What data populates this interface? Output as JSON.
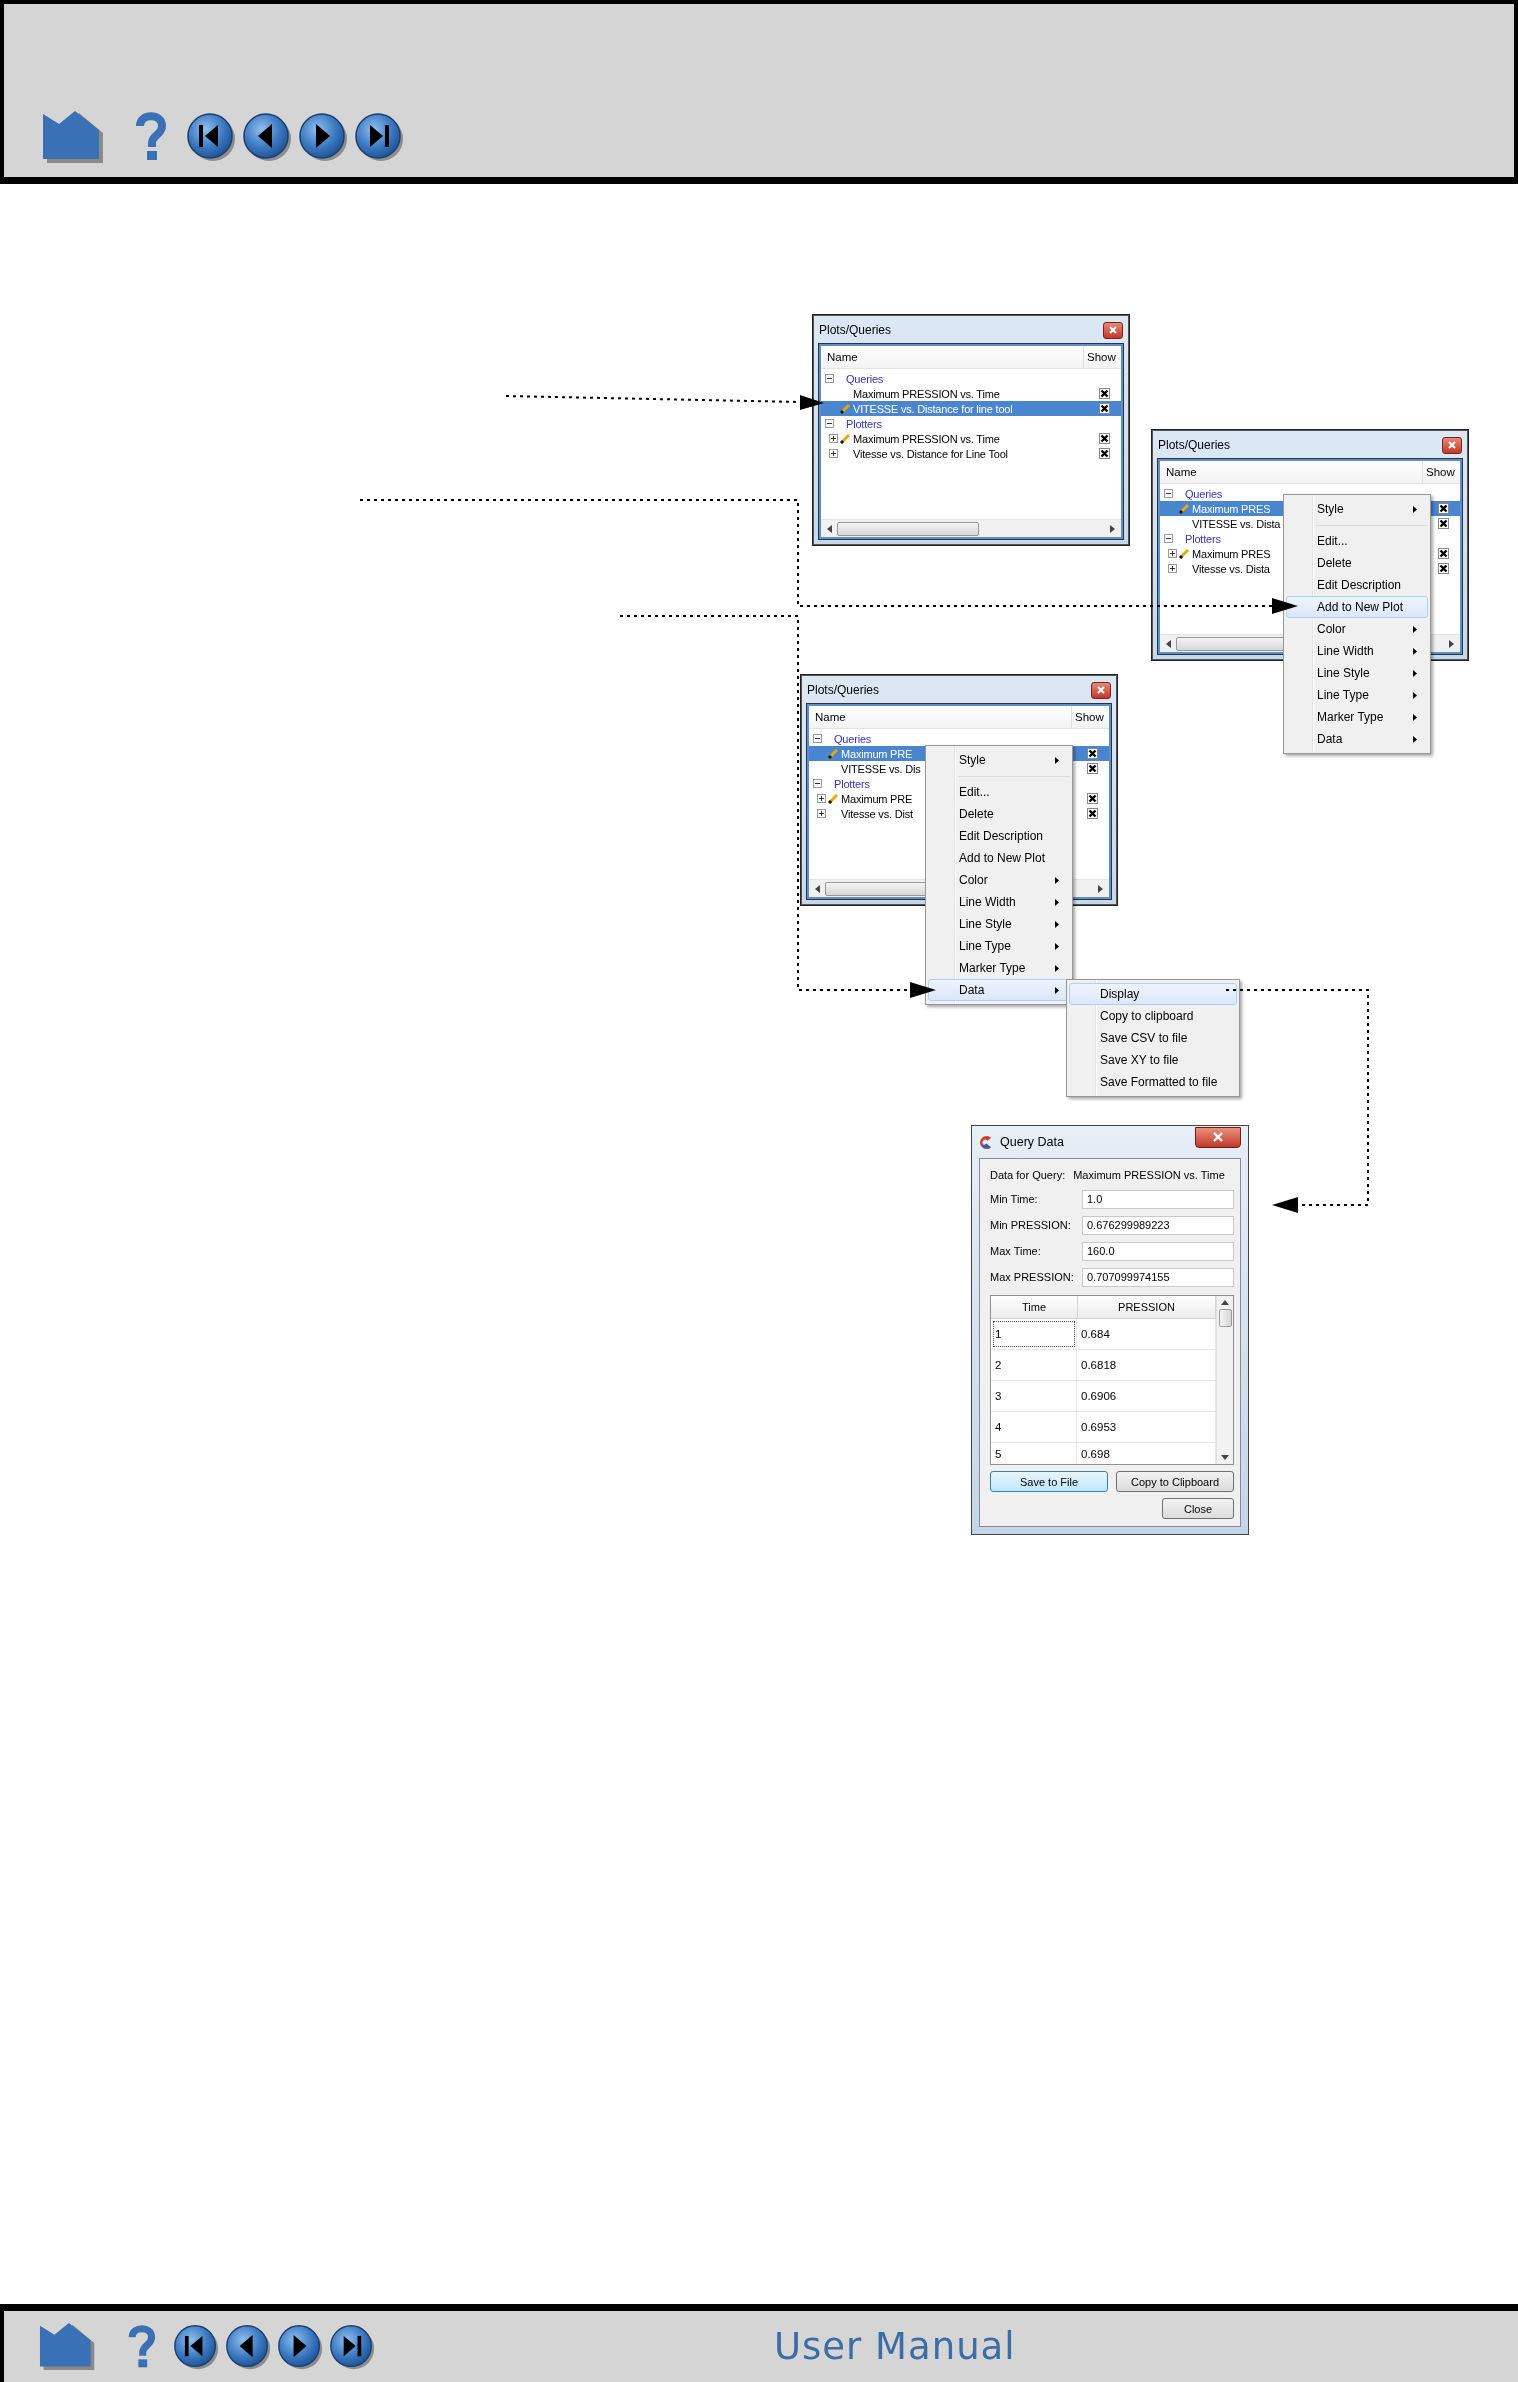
{
  "figures": [
    {
      "title": "Plots/Queries",
      "columns": [
        "Name",
        "Show"
      ],
      "tree": [
        {
          "label": "Queries",
          "expanded": true,
          "children": [
            {
              "label": "Maximum PRESSION vs. Time",
              "selected": false,
              "active": false,
              "has_children": false,
              "shown": true
            },
            {
              "label": "VITESSE vs. Distance for line tool",
              "selected": true,
              "active": true,
              "has_children": false,
              "shown": true
            }
          ]
        },
        {
          "label": "Plotters",
          "expanded": true,
          "children": [
            {
              "label": "Maximum PRESSION vs. Time",
              "selected": false,
              "active": true,
              "has_children": true,
              "shown": true
            },
            {
              "label": "Vitesse vs. Distance for Line Tool",
              "selected": false,
              "active": false,
              "has_children": true,
              "shown": true
            }
          ]
        }
      ]
    },
    {
      "title": "Plots/Queries",
      "columns": [
        "Name",
        "Show"
      ],
      "tree": [
        {
          "label": "Queries",
          "expanded": true,
          "children": [
            {
              "label": "Maximum PRES",
              "selected": true,
              "active": true,
              "has_children": false,
              "shown": true
            },
            {
              "label": "VITESSE vs. Dista",
              "selected": false,
              "active": false,
              "has_children": false,
              "shown": true
            }
          ]
        },
        {
          "label": "Plotters",
          "expanded": true,
          "children": [
            {
              "label": "Maximum PRES",
              "selected": false,
              "active": true,
              "has_children": true,
              "shown": true
            },
            {
              "label": "Vitesse vs. Dista",
              "selected": false,
              "active": false,
              "has_children": true,
              "shown": true
            }
          ]
        }
      ],
      "context_menu": {
        "items": [
          {
            "kind": "item",
            "label": "Style",
            "has_submenu": true,
            "selected": false
          },
          {
            "kind": "separator"
          },
          {
            "kind": "item",
            "label": "Edit...",
            "has_submenu": false,
            "selected": false
          },
          {
            "kind": "item",
            "label": "Delete",
            "has_submenu": false,
            "selected": false
          },
          {
            "kind": "item",
            "label": "Edit Description",
            "has_submenu": false,
            "selected": false
          },
          {
            "kind": "item",
            "label": "Add to New Plot",
            "has_submenu": false,
            "selected": true
          },
          {
            "kind": "item",
            "label": "Color",
            "has_submenu": true,
            "selected": false
          },
          {
            "kind": "item",
            "label": "Line Width",
            "has_submenu": true,
            "selected": false
          },
          {
            "kind": "item",
            "label": "Line Style",
            "has_submenu": true,
            "selected": false
          },
          {
            "kind": "item",
            "label": "Line Type",
            "has_submenu": true,
            "selected": false
          },
          {
            "kind": "item",
            "label": "Marker Type",
            "has_submenu": true,
            "selected": false
          },
          {
            "kind": "item",
            "label": "Data",
            "has_submenu": true,
            "selected": false
          }
        ]
      }
    },
    {
      "title": "Plots/Queries",
      "columns": [
        "Name",
        "Show"
      ],
      "tree": [
        {
          "label": "Queries",
          "expanded": true,
          "children": [
            {
              "label": "Maximum PRE",
              "selected": true,
              "active": true,
              "has_children": false,
              "shown": true
            },
            {
              "label": "VITESSE vs. Dis",
              "selected": false,
              "active": false,
              "has_children": false,
              "shown": true
            }
          ]
        },
        {
          "label": "Plotters",
          "expanded": true,
          "children": [
            {
              "label": "Maximum PRE",
              "selected": false,
              "active": true,
              "has_children": true,
              "shown": true
            },
            {
              "label": "Vitesse vs. Dist",
              "selected": false,
              "active": false,
              "has_children": true,
              "shown": true
            }
          ]
        }
      ],
      "context_menu": {
        "items": [
          {
            "kind": "item",
            "label": "Style",
            "has_submenu": true,
            "selected": false
          },
          {
            "kind": "separator"
          },
          {
            "kind": "item",
            "label": "Edit...",
            "has_submenu": false,
            "selected": false
          },
          {
            "kind": "item",
            "label": "Delete",
            "has_submenu": false,
            "selected": false
          },
          {
            "kind": "item",
            "label": "Edit Description",
            "has_submenu": false,
            "selected": false
          },
          {
            "kind": "item",
            "label": "Add to New Plot",
            "has_submenu": false,
            "selected": false
          },
          {
            "kind": "item",
            "label": "Color",
            "has_submenu": true,
            "selected": false
          },
          {
            "kind": "item",
            "label": "Line Width",
            "has_submenu": true,
            "selected": false
          },
          {
            "kind": "item",
            "label": "Line Style",
            "has_submenu": true,
            "selected": false
          },
          {
            "kind": "item",
            "label": "Line Type",
            "has_submenu": true,
            "selected": false
          },
          {
            "kind": "item",
            "label": "Marker Type",
            "has_submenu": true,
            "selected": false
          },
          {
            "kind": "item",
            "label": "Data",
            "has_submenu": true,
            "selected": true
          }
        ]
      },
      "submenu": {
        "items": [
          {
            "kind": "item",
            "label": "Display",
            "has_submenu": false,
            "selected": true
          },
          {
            "kind": "item",
            "label": "Copy to clipboard",
            "has_submenu": false,
            "selected": false
          },
          {
            "kind": "item",
            "label": "Save CSV to file",
            "has_submenu": false,
            "selected": false
          },
          {
            "kind": "item",
            "label": "Save XY to file",
            "has_submenu": false,
            "selected": false
          },
          {
            "kind": "item",
            "label": "Save Formatted to file",
            "has_submenu": false,
            "selected": false
          }
        ]
      }
    }
  ],
  "query_dialog": {
    "title": "Query Data",
    "query_label": "Data for Query:",
    "query_name": "Maximum PRESSION vs. Time",
    "fields": [
      {
        "label": "Min Time:",
        "value": "1.0"
      },
      {
        "label": "Min PRESSION:",
        "value": "0.676299989223"
      },
      {
        "label": "Max Time:",
        "value": "160.0"
      },
      {
        "label": "Max PRESSION:",
        "value": "0.707099974155"
      }
    ],
    "table": {
      "columns": [
        "Time",
        "PRESSION"
      ],
      "rows": [
        {
          "cells": [
            "1",
            "0.684"
          ],
          "focused": true
        },
        {
          "cells": [
            "2",
            "0.6818"
          ],
          "focused": false
        },
        {
          "cells": [
            "3",
            "0.6906"
          ],
          "focused": false
        },
        {
          "cells": [
            "4",
            "0.6953"
          ],
          "focused": false
        },
        {
          "cells": [
            "5",
            "0.698"
          ],
          "focused": false
        }
      ]
    },
    "buttons": [
      {
        "label": "Save to File",
        "default": true
      },
      {
        "label": "Copy to Clipboard",
        "default": false
      },
      {
        "label": "Close",
        "default": false
      }
    ]
  },
  "footer": {
    "title": "User Manual"
  }
}
